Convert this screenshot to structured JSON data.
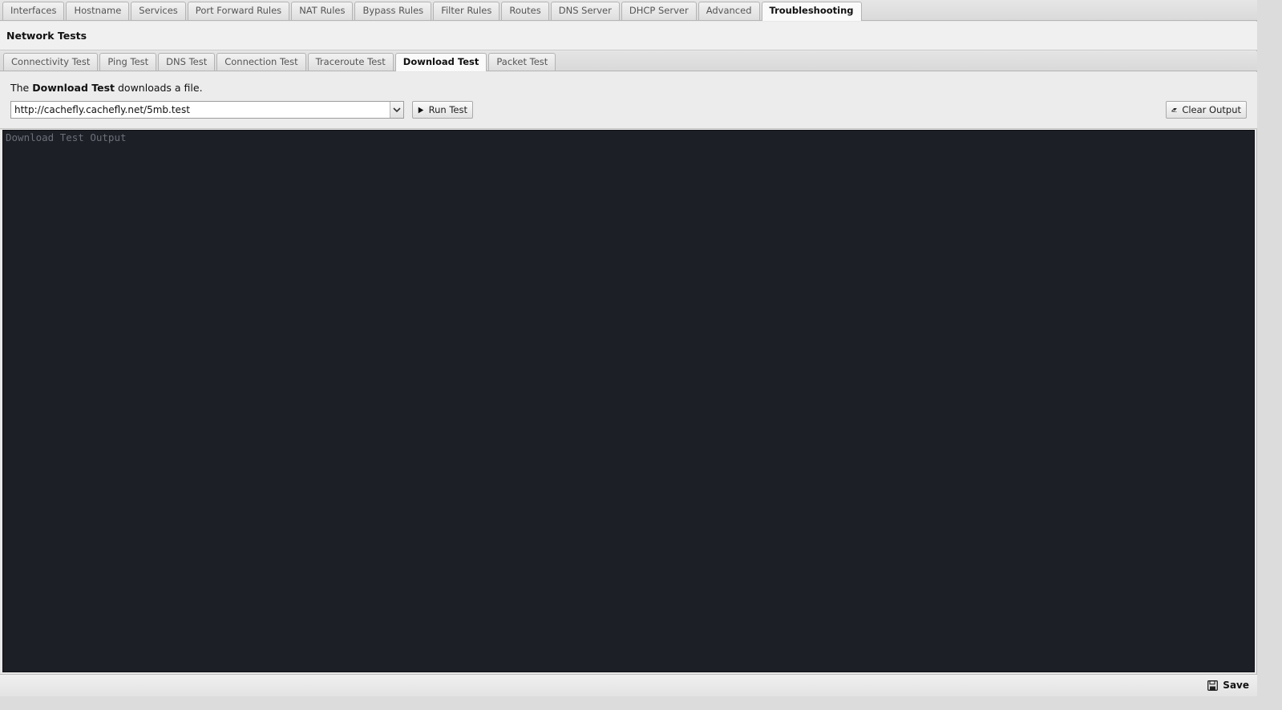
{
  "main_tabs": {
    "items": [
      "Interfaces",
      "Hostname",
      "Services",
      "Port Forward Rules",
      "NAT Rules",
      "Bypass Rules",
      "Filter Rules",
      "Routes",
      "DNS Server",
      "DHCP Server",
      "Advanced",
      "Troubleshooting"
    ],
    "active": "Troubleshooting"
  },
  "section": {
    "title": "Network Tests"
  },
  "sub_tabs": {
    "items": [
      "Connectivity Test",
      "Ping Test",
      "DNS Test",
      "Connection Test",
      "Traceroute Test",
      "Download Test",
      "Packet Test"
    ],
    "active": "Download Test"
  },
  "description": {
    "prefix": "The ",
    "emphasis": "Download Test",
    "suffix": " downloads a file."
  },
  "url_combo": {
    "value": "http://cachefly.cachefly.net/5mb.test"
  },
  "buttons": {
    "run": "Run Test",
    "clear": "Clear Output",
    "save": "Save"
  },
  "output": {
    "placeholder": "Download Test Output"
  },
  "colors": {
    "output_bg": "#1d1f27",
    "output_placeholder": "#6c6f78"
  }
}
